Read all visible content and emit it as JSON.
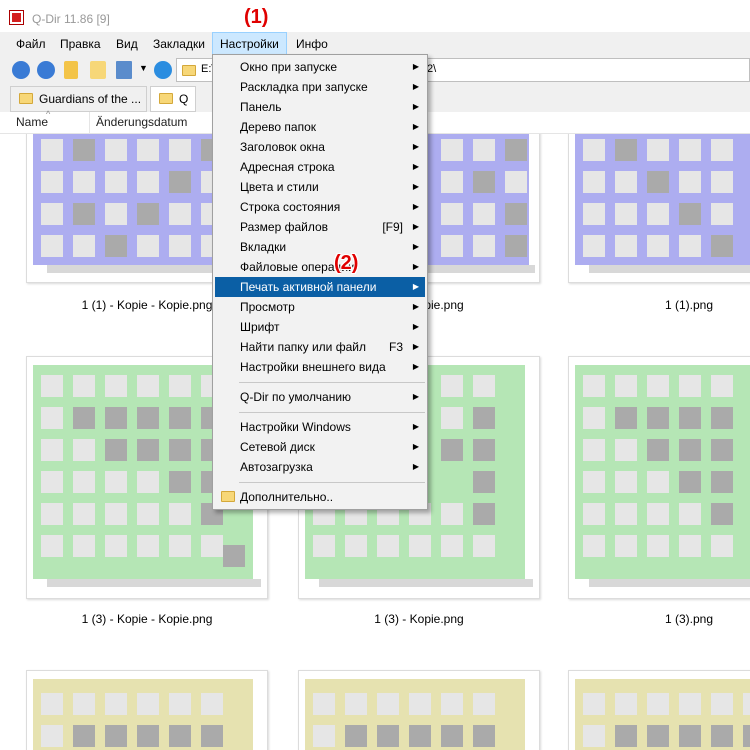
{
  "window": {
    "title": "Q-Dir 11.86 [9]"
  },
  "menubar": {
    "items": [
      "Файл",
      "Правка",
      "Вид",
      "Закладки",
      "Настройки",
      "Инфо"
    ]
  },
  "address": {
    "path_start": "E:\\",
    "path_end": "2\\"
  },
  "tabs": [
    {
      "label": "Guardians of the ..."
    },
    {
      "label": "Q"
    }
  ],
  "columns": {
    "name": "Name",
    "date": "Änderungsdatum"
  },
  "annotations": {
    "one": "(1)",
    "two": "(2)"
  },
  "colors": {
    "purple": "#adadf0",
    "green": "#b5e6b5",
    "yellow": "#e6e2b0",
    "highlight": "#0b5fa5"
  },
  "files": [
    {
      "caption": "1 (1) - Kopie - Kopie.png"
    },
    {
      "caption": "1 (1) - Kopie.png"
    },
    {
      "caption": "1 (1).png"
    },
    {
      "caption": "1 (3) - Kopie - Kopie.png"
    },
    {
      "caption": "1 (3) - Kopie.png"
    },
    {
      "caption": "1 (3).png"
    }
  ],
  "menu": {
    "items": [
      {
        "label": "Окно при запуске",
        "arrow": "▶"
      },
      {
        "label": "Раскладка при запуске",
        "arrow": "▶"
      },
      {
        "label": "Панель",
        "arrow": "▶"
      },
      {
        "label": "Дерево папок",
        "arrow": "▶"
      },
      {
        "label": "Заголовок окна",
        "arrow": "▶"
      },
      {
        "label": "Адресная строка",
        "arrow": "▶"
      },
      {
        "label": "Цвета и стили",
        "arrow": "▶"
      },
      {
        "label": "Строка состояния",
        "arrow": "▶"
      },
      {
        "label": "Размер файлов",
        "shortcut": "[F9]",
        "arrow": "▶"
      },
      {
        "label": "Вкладки",
        "arrow": "▶"
      },
      {
        "label": "Файловые операции",
        "arrow": "▶"
      },
      {
        "label": "Печать активной панели",
        "arrow": "▶"
      },
      {
        "label": "Просмотр",
        "arrow": "▶"
      },
      {
        "label": "Шрифт",
        "arrow": "▶"
      },
      {
        "label": "Найти папку или файл",
        "shortcut": "F3",
        "arrow": "▶"
      },
      {
        "label": "Настройки внешнего вида",
        "arrow": "▶"
      },
      {
        "label": "Q-Dir по умолчанию",
        "arrow": "▶"
      },
      {
        "label": "Настройки Windows",
        "arrow": "▶"
      },
      {
        "label": "Сетевой диск",
        "arrow": "▶"
      },
      {
        "label": "Автозагрузка",
        "arrow": "▶"
      },
      {
        "label": "Дополнительно.."
      }
    ]
  }
}
